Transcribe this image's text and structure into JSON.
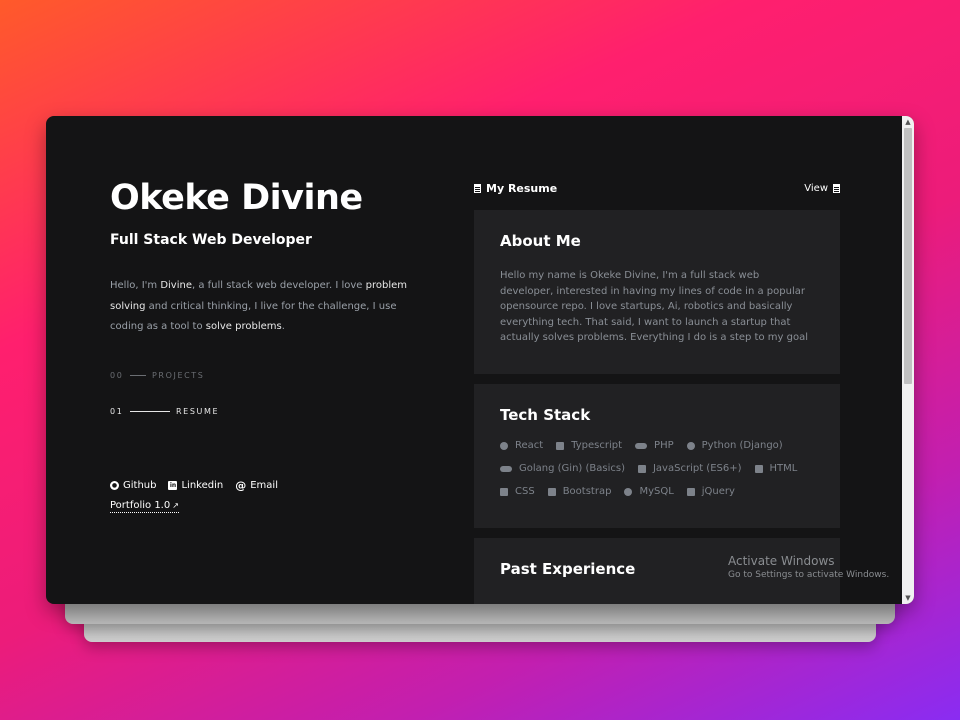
{
  "profile": {
    "name": "Okeke Divine",
    "role": "Full Stack Web Developer",
    "intro": {
      "part1": "Hello, I'm ",
      "name": "Divine",
      "part2": ", a full stack web developer. I love ",
      "problem": "problem solving",
      "part3": " and critical thinking, I live for the challenge, I use coding as a tool to ",
      "solve": "solve problems",
      "part4": "."
    }
  },
  "nav": [
    {
      "num": "00",
      "label": "PROJECTS",
      "active": false
    },
    {
      "num": "01",
      "label": "RESUME",
      "active": true
    }
  ],
  "social": {
    "github": "Github",
    "linkedin": "Linkedin",
    "email": "Email",
    "portfolio": "Portfolio 1.0"
  },
  "resume": {
    "title": "My Resume",
    "view": "View"
  },
  "about": {
    "title": "About Me",
    "text": "Hello my name is Okeke Divine, I'm a full stack web developer, interested in having my lines of code in a popular opensource repo. I love startups, Ai, robotics and basically everything tech. That said, I want to launch a startup that actually solves problems. Everything I do is a step to my goal"
  },
  "tech": {
    "title": "Tech Stack",
    "items": [
      "React",
      "Typescript",
      "PHP",
      "Python (Django)",
      "Golang (Gin) (Basics)",
      "JavaScript (ES6+)",
      "HTML",
      "CSS",
      "Bootstrap",
      "MySQL",
      "jQuery"
    ]
  },
  "experience": {
    "title": "Past Experience"
  },
  "watermark": {
    "line1": "Activate Windows",
    "line2": "Go to Settings to activate Windows."
  },
  "colors": {
    "accent_gradient_start": "#ff5a2a",
    "accent_gradient_end": "#8a2cf2",
    "panel": "#141415",
    "card": "#212123"
  }
}
